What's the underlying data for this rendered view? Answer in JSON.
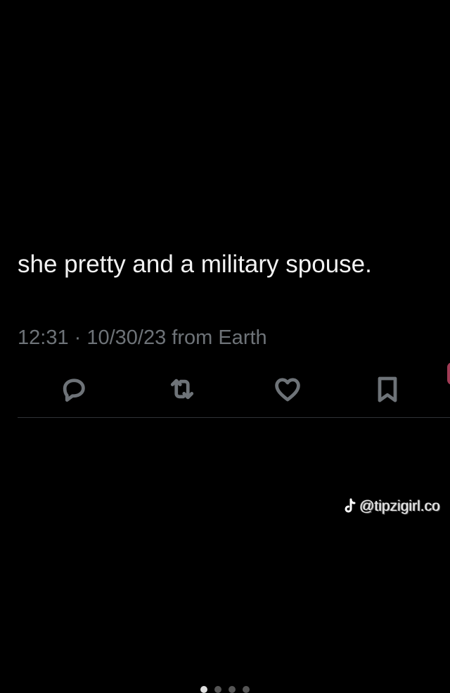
{
  "tweet": {
    "text": "she pretty and a military spouse.",
    "timestamp": "12:31 · 10/30/23 from Earth"
  },
  "actions": [
    {
      "name": "reply",
      "icon": "reply-icon"
    },
    {
      "name": "retweet",
      "icon": "retweet-icon"
    },
    {
      "name": "like",
      "icon": "heart-icon"
    },
    {
      "name": "bookmark",
      "icon": "bookmark-icon"
    }
  ],
  "watermark": {
    "handle": "@tipzigirl.co",
    "icon": "tiktok-icon"
  },
  "pager": {
    "count": 4,
    "active_index": 0
  },
  "colors": {
    "background": "#000000",
    "text": "#f2f2f2",
    "muted": "#6e7378",
    "divider": "#2f3336"
  }
}
